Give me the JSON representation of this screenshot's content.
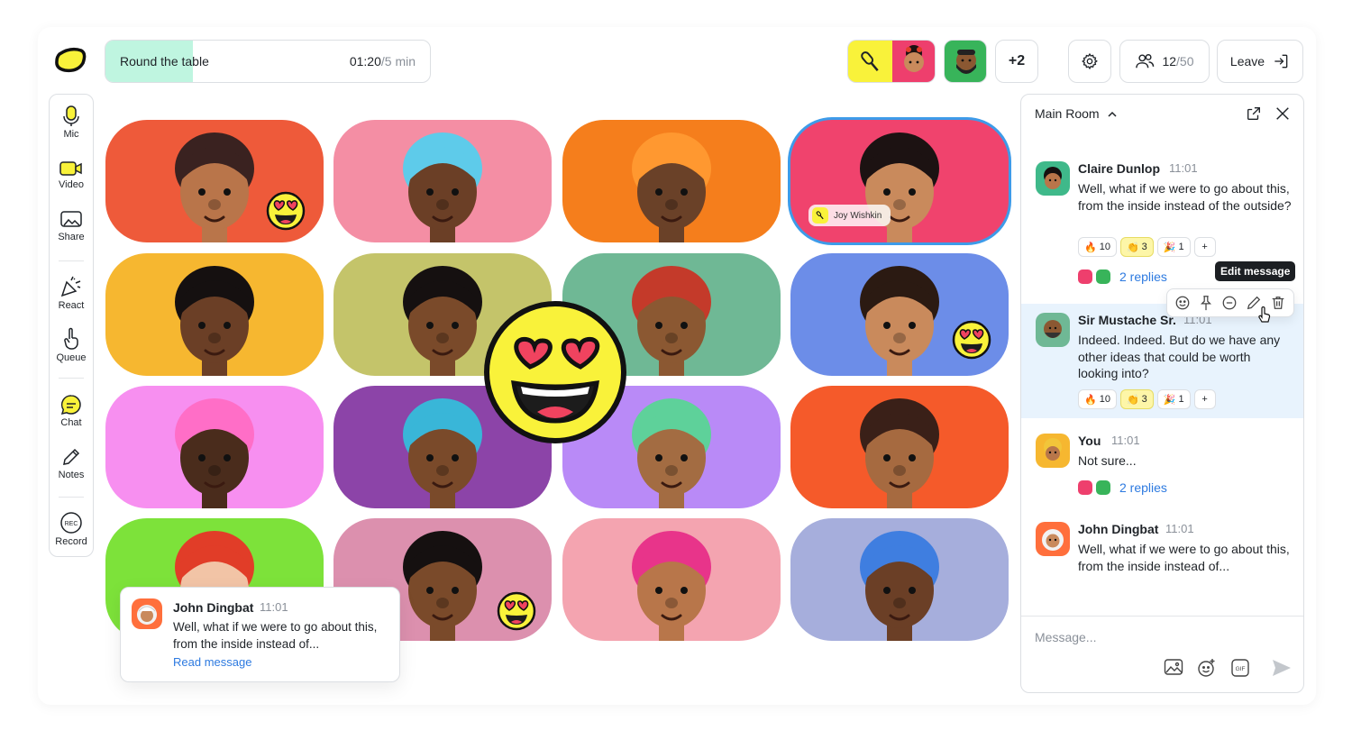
{
  "activity": {
    "title": "Round the table",
    "elapsed": "01:20",
    "total": "/5 min",
    "progress": 0.27
  },
  "queue": {
    "overflow": "+2"
  },
  "header": {
    "participants_count": "12",
    "participants_max": "/50",
    "leave_label": "Leave"
  },
  "sidebar": {
    "items": [
      {
        "label": "Mic"
      },
      {
        "label": "Video"
      },
      {
        "label": "Share"
      },
      {
        "label": "React"
      },
      {
        "label": "Queue"
      },
      {
        "label": "Chat"
      },
      {
        "label": "Notes"
      },
      {
        "label": "Record"
      }
    ]
  },
  "speaker": {
    "name": "Joy Wishkin"
  },
  "colors": {
    "accent": "#2d7ae0",
    "active_border": "#3d9be9",
    "highlight": "#f9f23a"
  },
  "notification": {
    "name": "John Dingbat",
    "time": "11:01",
    "text": "Well, what if we were to go about this, from the inside instead of...",
    "link": "Read message"
  },
  "chat": {
    "room": "Main Room",
    "tooltip": "Edit message",
    "input_placeholder": "Message...",
    "messages": [
      {
        "name": "Claire Dunlop",
        "time": "11:01",
        "text": "Well, what if we were to go about this, from the inside instead of the outside?",
        "reactions": [
          {
            "emoji": "🔥",
            "count": "10"
          },
          {
            "emoji": "👏",
            "count": "3"
          },
          {
            "emoji": "🎉",
            "count": "1"
          }
        ],
        "replies": "2 replies"
      },
      {
        "name": "Sir Mustache Sr.",
        "time": "11:01",
        "text": "Indeed. Indeed. But do we have any other ideas that could be worth looking into?",
        "reactions": [
          {
            "emoji": "🔥",
            "count": "10"
          },
          {
            "emoji": "👏",
            "count": "3"
          },
          {
            "emoji": "🎉",
            "count": "1"
          }
        ]
      },
      {
        "name": "You",
        "time": "11:01",
        "text": "Not sure...",
        "replies": "2 replies"
      },
      {
        "name": "John Dingbat",
        "time": "11:01",
        "text": "Well, what if we were to go about this, from the inside instead of..."
      }
    ]
  },
  "tiles": [
    {
      "bg": "#ee5a3a",
      "skin": "#b9754a",
      "hair": "#3a2220"
    },
    {
      "bg": "#f48ea4",
      "skin": "#6b3f26",
      "hair": "#5ecbea"
    },
    {
      "bg": "#f57e1c",
      "skin": "#6a4128",
      "hair": "#ff9830"
    },
    {
      "bg": "#f0436d",
      "skin": "#c98a5c",
      "hair": "#1c1212"
    },
    {
      "bg": "#f6b730",
      "skin": "#6b3f26",
      "hair": "#151010"
    },
    {
      "bg": "#c4c46a",
      "skin": "#7a4a2a",
      "hair": "#151010"
    },
    {
      "bg": "#6fb895",
      "skin": "#8b5832",
      "hair": "#c43a2a"
    },
    {
      "bg": "#6c8de8",
      "skin": "#c98a5c",
      "hair": "#2b1a12"
    },
    {
      "bg": "#f78ff0",
      "skin": "#4a2c1c",
      "hair": "#ff6ec7"
    },
    {
      "bg": "#8c44a8",
      "skin": "#7a4a2a",
      "hair": "#39b6d8"
    },
    {
      "bg": "#b98af7",
      "skin": "#a36c42",
      "hair": "#5ed19a"
    },
    {
      "bg": "#f55a2a",
      "skin": "#a66a40",
      "hair": "#3a2018"
    },
    {
      "bg": "#7de23a",
      "skin": "#f2c4a6",
      "hair": "#e13d28"
    },
    {
      "bg": "#dc90ae",
      "skin": "#7a4a2a",
      "hair": "#151010"
    },
    {
      "bg": "#f4a4b0",
      "skin": "#b8764a",
      "hair": "#e8348a"
    },
    {
      "bg": "#a6aedc",
      "skin": "#6b3f26",
      "hair": "#3f7ee0"
    }
  ]
}
